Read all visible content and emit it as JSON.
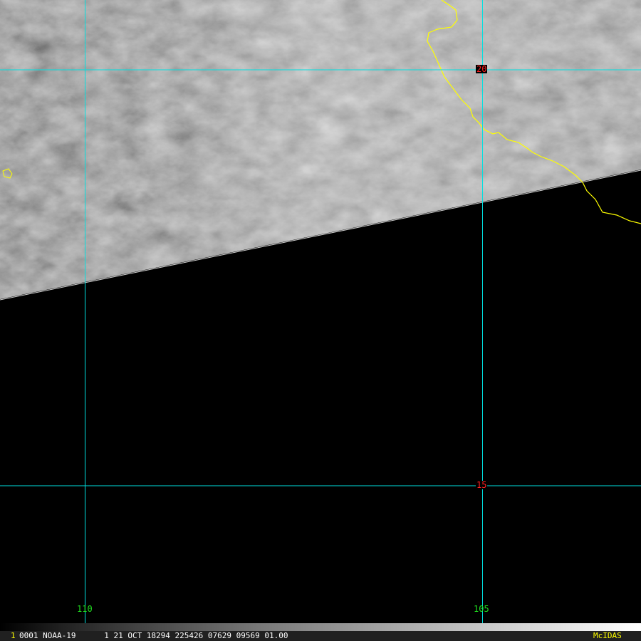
{
  "image": {
    "satellite": "NOAA-19",
    "content": "visible satellite imagery with cloud cover and coastline"
  },
  "grid": {
    "lat_labels": [
      "20",
      "15"
    ],
    "lon_labels": [
      "110",
      "105"
    ]
  },
  "colors": {
    "grid": "#00e0e0",
    "coastline": "#ffff00",
    "lat_label": "#ff2020",
    "lon_label": "#20e020",
    "brand": "#ffff00"
  },
  "status_bar": {
    "frame_index": "1",
    "info": "0001 NOAA-19      1 21 OCT 18294 225426 07629 09569 01.00",
    "brand": "McIDAS"
  }
}
